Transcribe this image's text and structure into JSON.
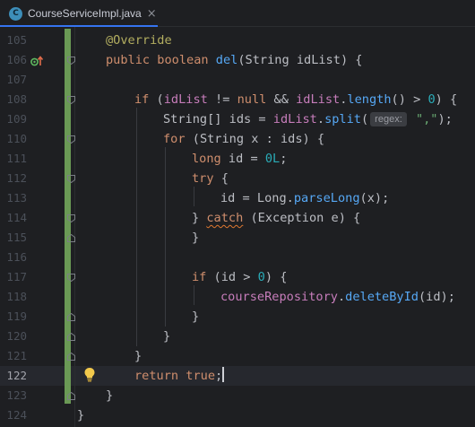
{
  "tab": {
    "title": "CourseServiceImpl.java",
    "icon_letter": "C",
    "close": "×"
  },
  "code": {
    "line_numbers": [
      "105",
      "106",
      "107",
      "108",
      "109",
      "110",
      "111",
      "112",
      "113",
      "114",
      "115",
      "116",
      "117",
      "118",
      "119",
      "120",
      "121",
      "122",
      "123",
      "124"
    ],
    "current_line": "122",
    "inlay_hint": "regex:"
  },
  "colors": {
    "keyword": "#cf8e6d",
    "function": "#56a8f5",
    "field": "#c77dbb",
    "number": "#2aacb8",
    "string": "#6aab73",
    "annotation": "#b3ae60",
    "vcs_bar": "#6a9955"
  },
  "icons": {
    "override": "implements-up-arrow-icon",
    "intention": "lightbulb-icon"
  },
  "tokens": {
    "l105": {
      "override": "@Override"
    },
    "l106": {
      "public": "public",
      "boolean": "boolean",
      "name": "del",
      "open": "(",
      "type": "String",
      "param": " idList",
      "close": ") {"
    },
    "l108": {
      "if": "if",
      "open": " (",
      "var": "idList",
      "neq": " != ",
      "null": "null",
      "and": " && ",
      "var2": "idList",
      "dot": ".",
      "length": "length",
      "call": "() > ",
      "zero": "0",
      "close": ") {"
    },
    "l109": {
      "type": "String[] ids = ",
      "var": "idList",
      "dot": ".",
      "split": "split",
      "open": "(",
      "str": "\",\"",
      "close": ");"
    },
    "l110": {
      "for": "for",
      "open": " (",
      "type": "String x : ids",
      "close": ") {"
    },
    "l111": {
      "long": "long",
      "mid": " id = ",
      "num": "0L",
      "semi": ";"
    },
    "l112": {
      "try": "try",
      "brace": " {"
    },
    "l113": {
      "a": "id = Long.",
      "parse": "parseLong",
      "b": "(x);"
    },
    "l114": {
      "a": "} ",
      "catch": "catch",
      "b": " (Exception e) {"
    },
    "l115": {
      "a": "}"
    },
    "l117": {
      "if": "if",
      "a": " (id > ",
      "num": "0",
      "b": ") {"
    },
    "l118": {
      "repo": "courseRepository",
      "dot": ".",
      "del": "deleteById",
      "b": "(id);"
    },
    "l119": {
      "a": "}"
    },
    "l120": {
      "a": "}"
    },
    "l121": {
      "a": "}"
    },
    "l122": {
      "return": "return",
      "space": " ",
      "true": "true",
      "semi": ";"
    },
    "l123": {
      "a": "}"
    },
    "l124": {
      "a": "}"
    }
  }
}
